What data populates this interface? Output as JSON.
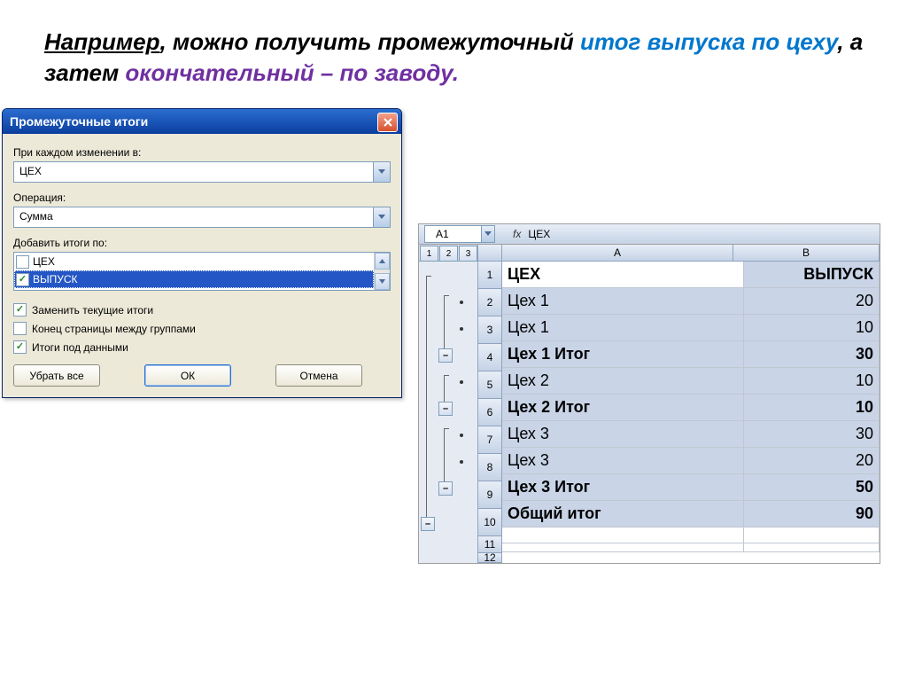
{
  "heading": {
    "p1": "Например",
    "p2": ", можно получить промежуточный ",
    "blue1": "итог выпуска по цеху",
    "p3": ", а затем ",
    "purple": "окончательный – по заводу."
  },
  "dialog": {
    "title": "Промежуточные итоги",
    "label_change": "При каждом изменении в:",
    "combo_change": "ЦЕХ",
    "label_op": "Операция:",
    "combo_op": "Сумма",
    "label_add": "Добавить итоги по:",
    "list": {
      "item0": {
        "label": "ЦЕХ",
        "checked": false
      },
      "item1": {
        "label": "ВЫПУСК",
        "checked": true
      }
    },
    "chk_replace": "Заменить текущие итоги",
    "chk_pagebreak": "Конец страницы между группами",
    "chk_below": "Итоги под данными",
    "btn_remove": "Убрать все",
    "btn_ok": "ОК",
    "btn_cancel": "Отмена"
  },
  "sheet": {
    "namebox": "A1",
    "fx": "fx",
    "formula": "ЦЕХ",
    "levels": {
      "l1": "1",
      "l2": "2",
      "l3": "3"
    },
    "col": {
      "A": "A",
      "B": "B"
    },
    "rows": [
      {
        "n": "1",
        "a": "ЦЕХ",
        "b": "ВЫПУСК",
        "bold": true,
        "white": true
      },
      {
        "n": "2",
        "a": "Цех 1",
        "b": "20",
        "bold": false
      },
      {
        "n": "3",
        "a": "Цех 1",
        "b": "10",
        "bold": false
      },
      {
        "n": "4",
        "a": "Цех 1 Итог",
        "b": "30",
        "bold": true
      },
      {
        "n": "5",
        "a": "Цех 2",
        "b": "10",
        "bold": false
      },
      {
        "n": "6",
        "a": "Цех 2 Итог",
        "b": "10",
        "bold": true
      },
      {
        "n": "7",
        "a": "Цех 3",
        "b": "30",
        "bold": false
      },
      {
        "n": "8",
        "a": "Цех 3",
        "b": "20",
        "bold": false
      },
      {
        "n": "9",
        "a": "Цех 3 Итог",
        "b": "50",
        "bold": true
      },
      {
        "n": "10",
        "a": "Общий итог",
        "b": "90",
        "bold": true
      },
      {
        "n": "11",
        "a": "",
        "b": "",
        "bold": false,
        "white": true
      },
      {
        "n": "12",
        "a": "",
        "b": "",
        "bold": false,
        "white": true
      }
    ]
  }
}
